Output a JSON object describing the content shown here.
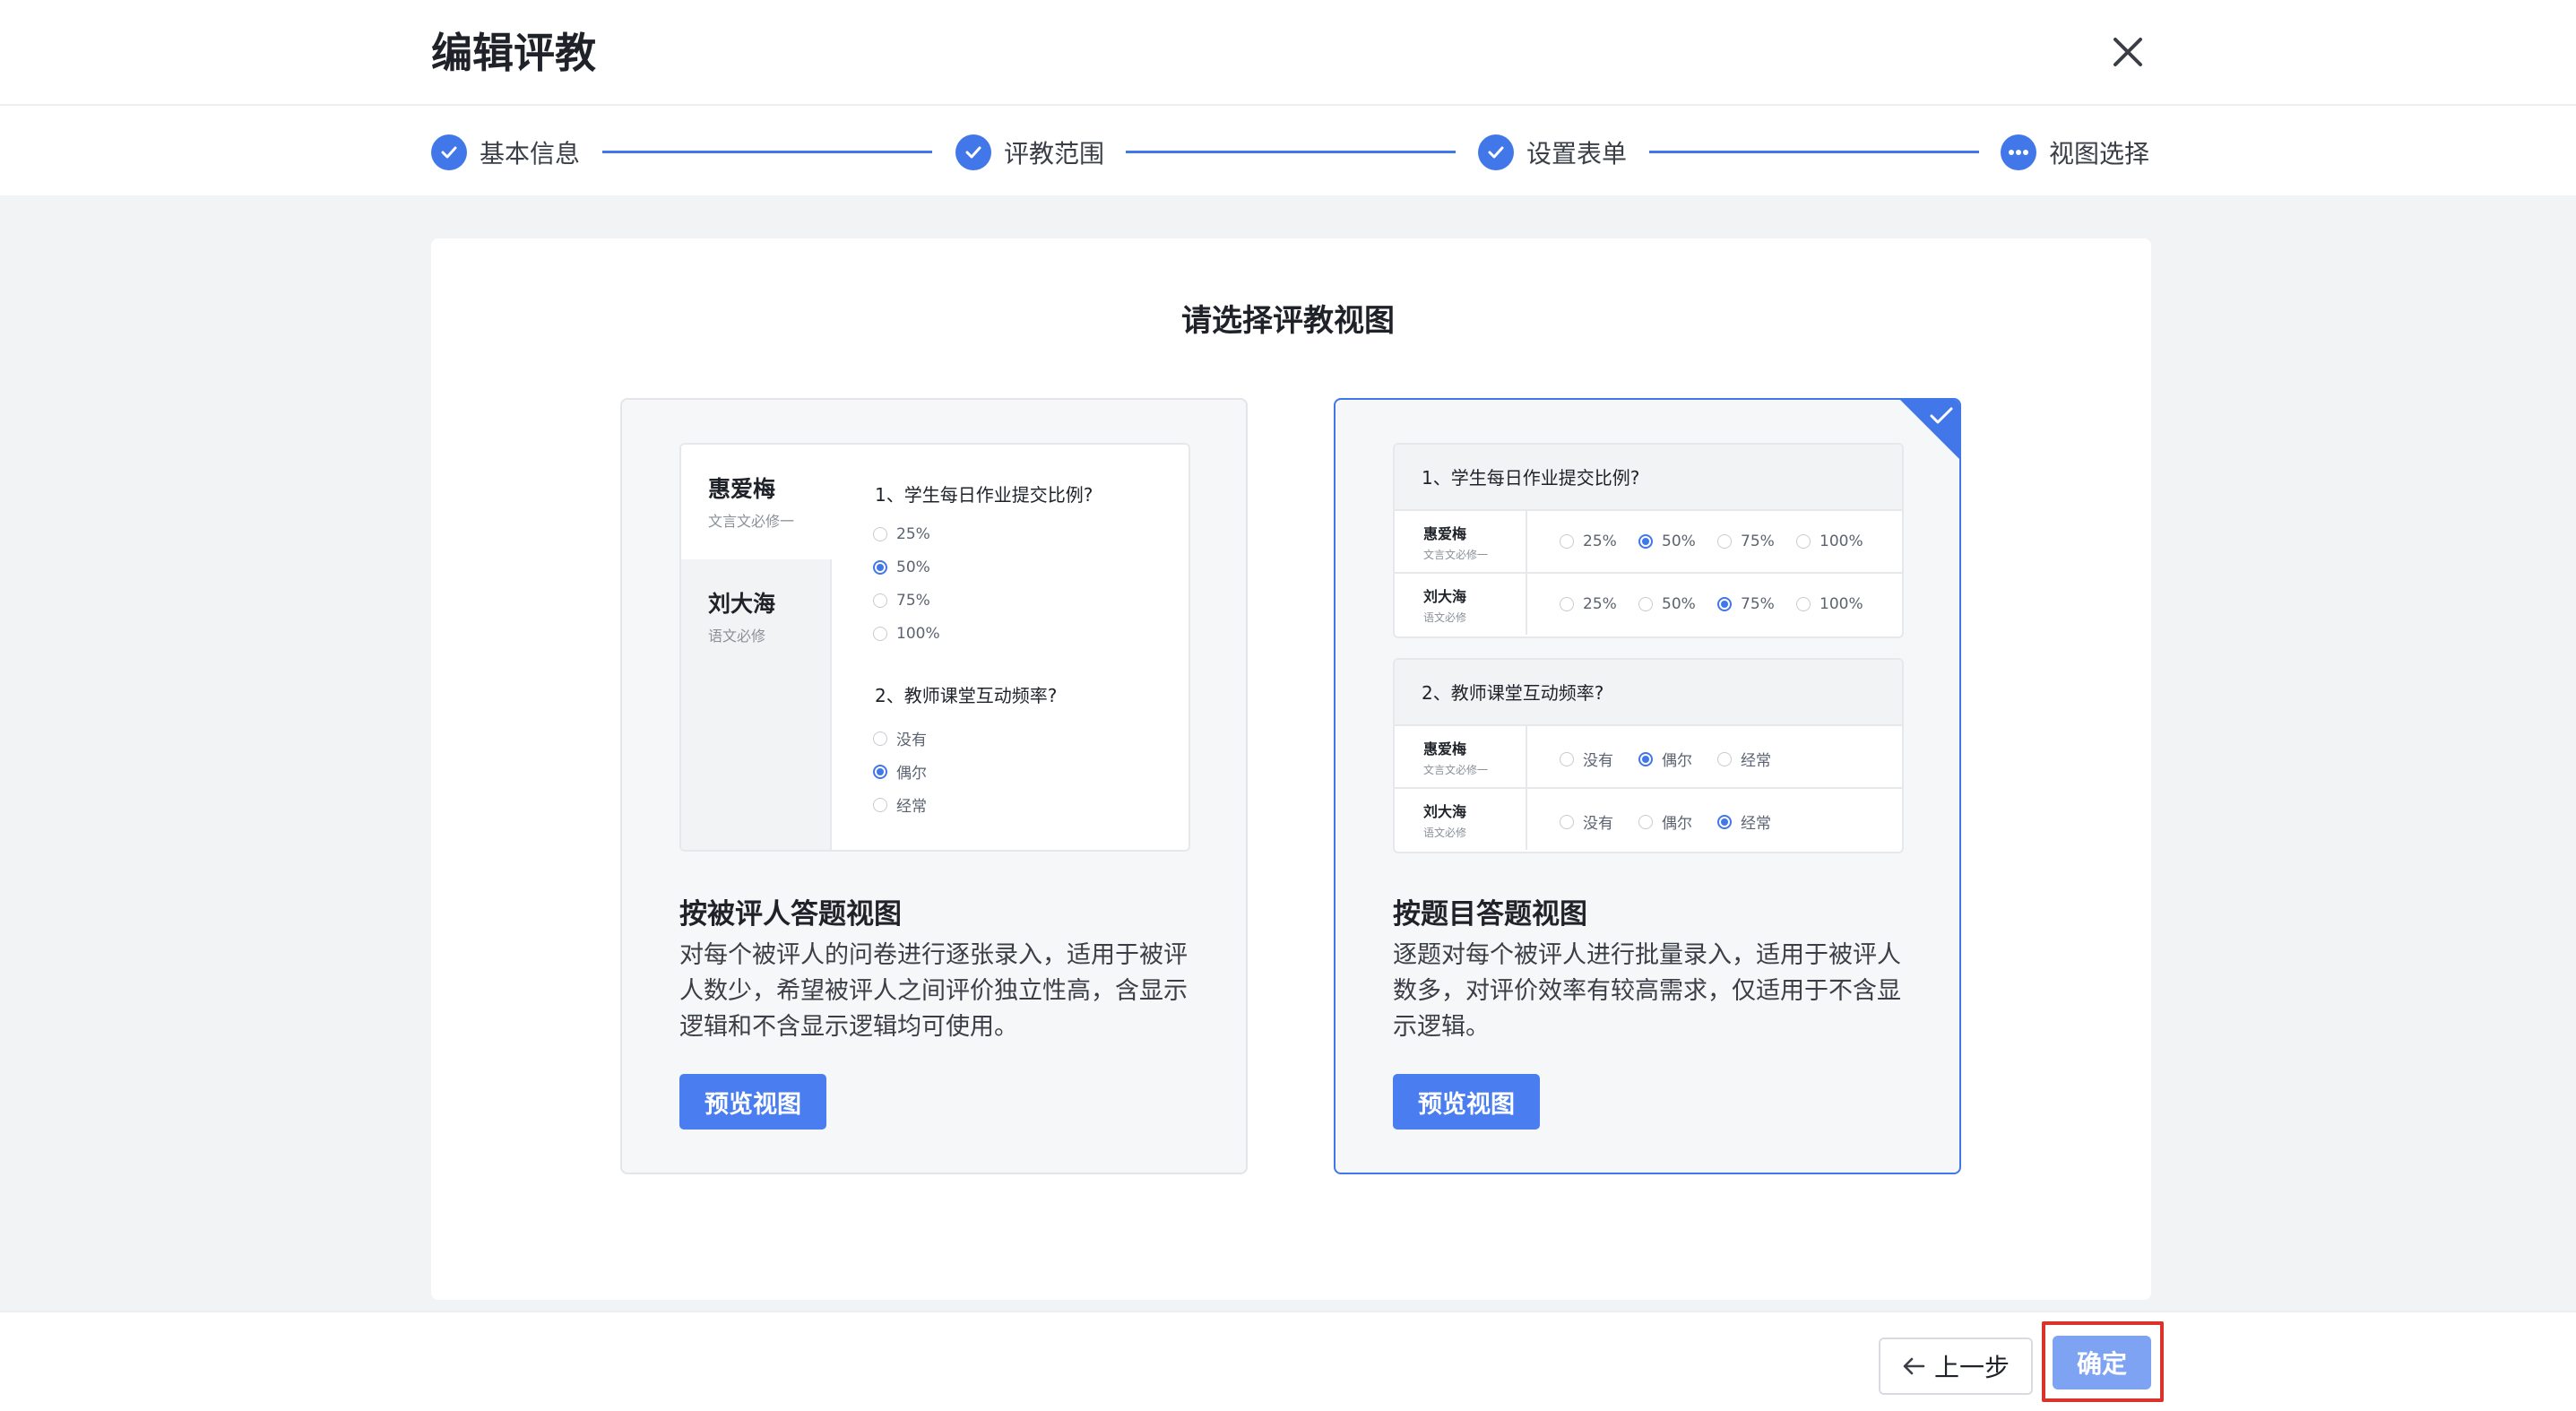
{
  "header": {
    "title": "编辑评教"
  },
  "steps": [
    {
      "label": "基本信息",
      "state": "done"
    },
    {
      "label": "评教范围",
      "state": "done"
    },
    {
      "label": "设置表单",
      "state": "done"
    },
    {
      "label": "视图选择",
      "state": "current"
    }
  ],
  "main": {
    "title": "请选择评教视图",
    "cards": [
      {
        "name": "按被评人答题视图",
        "desc": "对每个被评人的问卷进行逐张录入，适用于被评人数少，希望被评人之间评价独立性高，含显示逻辑和不含显示逻辑均可使用。",
        "preview_button": "预览视图",
        "selected": false,
        "preview": {
          "people": [
            {
              "name": "惠爱梅",
              "sub": "文言文必修一"
            },
            {
              "name": "刘大海",
              "sub": "语文必修"
            }
          ],
          "questions": [
            {
              "title": "1、学生每日作业提交比例?",
              "options": [
                "25%",
                "50%",
                "75%",
                "100%"
              ],
              "selected": 1
            },
            {
              "title": "2、教师课堂互动频率?",
              "options": [
                "没有",
                "偶尔",
                "经常"
              ],
              "selected": 1
            }
          ]
        }
      },
      {
        "name": "按题目答题视图",
        "desc": "逐题对每个被评人进行批量录入，适用于被评人数多，对评价效率有较高需求，仅适用于不含显示逻辑。",
        "preview_button": "预览视图",
        "selected": true,
        "preview": {
          "questions": [
            {
              "title": "1、学生每日作业提交比例?",
              "options": [
                "25%",
                "50%",
                "75%",
                "100%"
              ],
              "rows": [
                {
                  "name": "惠爱梅",
                  "sub": "文言文必修一",
                  "selected": 1
                },
                {
                  "name": "刘大海",
                  "sub": "语文必修",
                  "selected": 2
                }
              ]
            },
            {
              "title": "2、教师课堂互动频率?",
              "options": [
                "没有",
                "偶尔",
                "经常"
              ],
              "rows": [
                {
                  "name": "惠爱梅",
                  "sub": "文言文必修一",
                  "selected": 1
                },
                {
                  "name": "刘大海",
                  "sub": "语文必修",
                  "selected": 2
                }
              ]
            }
          ]
        }
      }
    ]
  },
  "footer": {
    "prev_label": "上一步",
    "confirm_label": "确定"
  },
  "colors": {
    "primary": "#4177e8",
    "confirm_disabled": "#7ea3f3",
    "highlight": "#d9342b"
  }
}
